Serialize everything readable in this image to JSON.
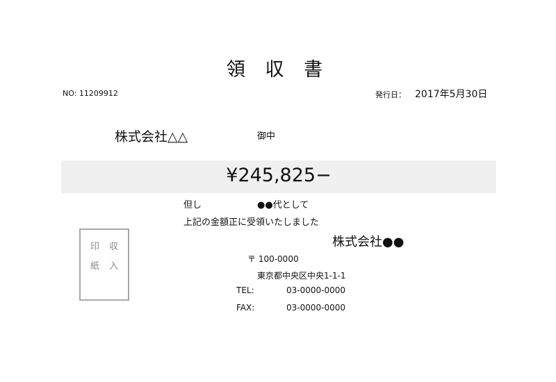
{
  "document": {
    "title": "領 収 書",
    "number": "NO: 11209912",
    "issue_date_label": "発行日：",
    "issue_date": "2017年5月30日"
  },
  "recipient": {
    "name": "株式会社△△",
    "honorific": "御中"
  },
  "amount": {
    "text": "¥245,825−"
  },
  "note": {
    "label": "但し",
    "purpose": "●●代として",
    "confirmation": "上記の金額正に受領いたしました"
  },
  "revenue_stamp": {
    "line1": "印収",
    "line2": "紙入"
  },
  "issuer": {
    "name": "株式会社●●",
    "postal": "〒 100-0000",
    "address": "東京都中央区中央1-1-1",
    "tel_label": "TEL:",
    "tel": "03-0000-0000",
    "fax_label": "FAX:",
    "fax": "03-0000-0000"
  }
}
